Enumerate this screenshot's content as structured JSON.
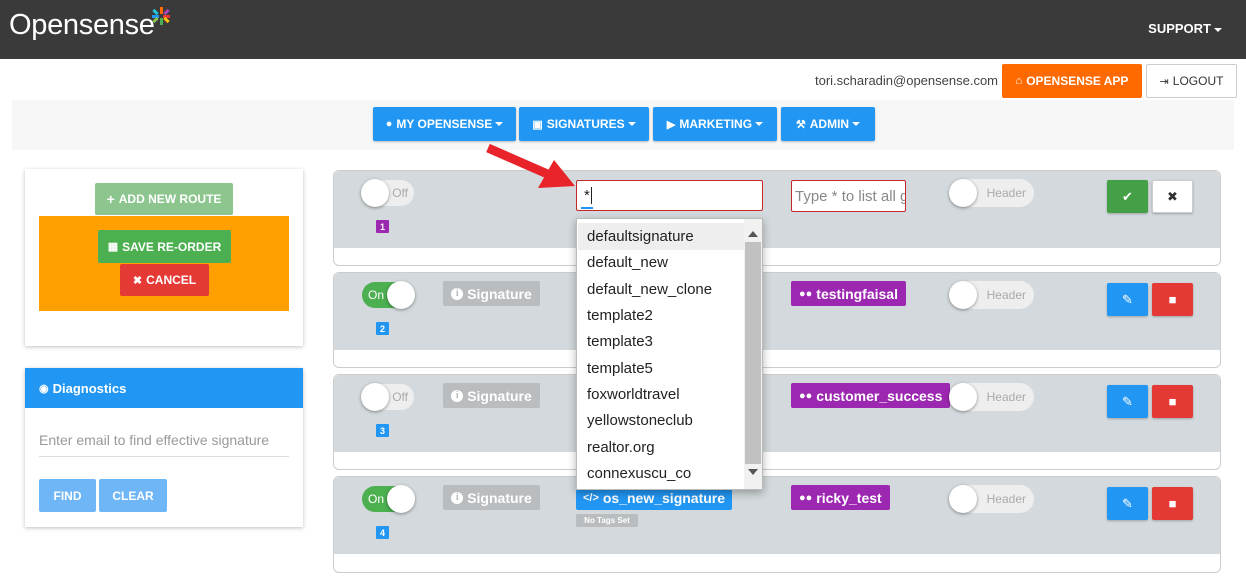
{
  "header": {
    "logo": "Opensense",
    "support_label": "SUPPORT"
  },
  "account": {
    "email": "tori.scharadin@opensense.com",
    "app_button": "OPENSENSE APP",
    "logout_button": "LOGOUT"
  },
  "nav": {
    "items": [
      {
        "label": "MY OPENSENSE"
      },
      {
        "label": "SIGNATURES"
      },
      {
        "label": "MARKETING"
      },
      {
        "label": "ADMIN"
      }
    ]
  },
  "routes_panel": {
    "add_label": "ADD NEW ROUTE",
    "save_label": "SAVE RE-ORDER",
    "cancel_label": "CANCEL"
  },
  "diagnostics": {
    "title": "Diagnostics",
    "placeholder": "Enter email to find effective signature",
    "find_label": "FIND",
    "clear_label": "CLEAR"
  },
  "editing_row": {
    "toggle": "Off",
    "number": "1",
    "signature_value": "*",
    "group_placeholder": "Type * to list all g",
    "header_toggle": "Header"
  },
  "dropdown": {
    "options": [
      "defaultsignature",
      "default_new",
      "default_new_clone",
      "template2",
      "template3",
      "template5",
      "foxworldtravel",
      "yellowstoneclub",
      "realtor.org",
      "connexuscu_co"
    ]
  },
  "routes": [
    {
      "toggle": "On",
      "number": "2",
      "type": "Signature",
      "group": "testingfaisal",
      "header": "Header"
    },
    {
      "toggle": "Off",
      "number": "3",
      "type": "Signature",
      "group": "customer_success",
      "header": "Header"
    },
    {
      "toggle": "On",
      "number": "4",
      "type": "Signature",
      "signature": "os_new_signature",
      "tags": "No Tags Set",
      "group": "ricky_test",
      "header": "Header"
    }
  ],
  "colors": {
    "primary": "#2196f3",
    "orange": "#ff6a00",
    "green": "#4caf50",
    "red": "#e53935",
    "purple": "#9c27b0"
  }
}
